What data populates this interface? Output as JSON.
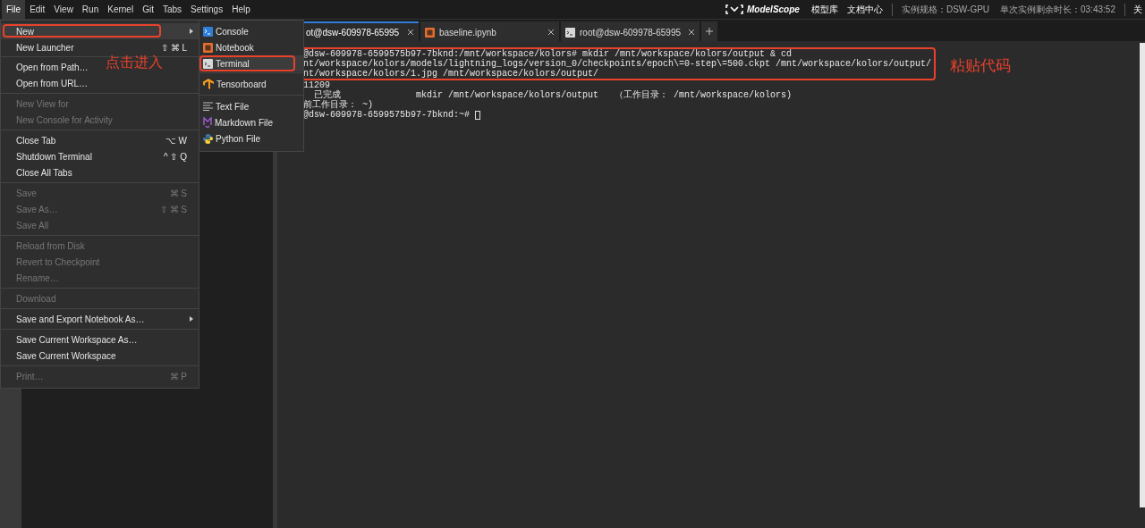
{
  "menubar": {
    "items": [
      {
        "label": "File",
        "selected": true
      },
      {
        "label": "Edit",
        "selected": false
      },
      {
        "label": "View",
        "selected": false
      },
      {
        "label": "Run",
        "selected": false
      },
      {
        "label": "Kernel",
        "selected": false
      },
      {
        "label": "Git",
        "selected": false
      },
      {
        "label": "Tabs",
        "selected": false
      },
      {
        "label": "Settings",
        "selected": false
      },
      {
        "label": "Help",
        "selected": false
      }
    ]
  },
  "header": {
    "brand": "ModelScope",
    "links": [
      "模型库",
      "文档中心"
    ],
    "instance_spec": "实例规格：DSW-GPU",
    "remaining_time": "单次实例剩余时长：03:43:52",
    "close": "关"
  },
  "file_menu": {
    "groups": [
      [
        {
          "label": "New",
          "disabled": false,
          "submenu": true,
          "selected": true,
          "outlined": true
        },
        {
          "label": "New Launcher",
          "shortcut": "⇧ ⌘ L",
          "disabled": false,
          "submenu": false,
          "selected": false,
          "outlined": false
        }
      ],
      [
        {
          "label": "Open from Path…",
          "disabled": false,
          "submenu": false,
          "selected": false,
          "outlined": false
        },
        {
          "label": "Open from URL…",
          "disabled": false,
          "submenu": false,
          "selected": false,
          "outlined": false
        }
      ],
      [
        {
          "label": "New View for",
          "disabled": true,
          "submenu": false,
          "selected": false,
          "outlined": false
        },
        {
          "label": "New Console for Activity",
          "disabled": true,
          "submenu": false,
          "selected": false,
          "outlined": false
        }
      ],
      [
        {
          "label": "Close Tab",
          "shortcut": "⌥ W",
          "disabled": false,
          "submenu": false,
          "selected": false,
          "outlined": false
        },
        {
          "label": "Shutdown Terminal",
          "shortcut": "^ ⇧ Q",
          "disabled": false,
          "submenu": false,
          "selected": false,
          "outlined": false
        },
        {
          "label": "Close All Tabs",
          "disabled": false,
          "submenu": false,
          "selected": false,
          "outlined": false
        }
      ],
      [
        {
          "label": "Save",
          "shortcut": "⌘ S",
          "disabled": true,
          "submenu": false,
          "selected": false,
          "outlined": false
        },
        {
          "label": "Save As…",
          "shortcut": "⇧ ⌘ S",
          "disabled": true,
          "submenu": false,
          "selected": false,
          "outlined": false
        },
        {
          "label": "Save All",
          "disabled": true,
          "submenu": false,
          "selected": false,
          "outlined": false
        }
      ],
      [
        {
          "label": "Reload from Disk",
          "disabled": true,
          "submenu": false,
          "selected": false,
          "outlined": false
        },
        {
          "label": "Revert to Checkpoint",
          "disabled": true,
          "submenu": false,
          "selected": false,
          "outlined": false
        },
        {
          "label": "Rename…",
          "disabled": true,
          "submenu": false,
          "selected": false,
          "outlined": false
        }
      ],
      [
        {
          "label": "Download",
          "disabled": true,
          "submenu": false,
          "selected": false,
          "outlined": false
        }
      ],
      [
        {
          "label": "Save and Export Notebook As…",
          "disabled": false,
          "submenu": true,
          "selected": false,
          "outlined": false
        }
      ],
      [
        {
          "label": "Save Current Workspace As…",
          "disabled": false,
          "submenu": false,
          "selected": false,
          "outlined": false
        },
        {
          "label": "Save Current Workspace",
          "disabled": false,
          "submenu": false,
          "selected": false,
          "outlined": false
        }
      ],
      [
        {
          "label": "Print…",
          "shortcut": "⌘ P",
          "disabled": true,
          "submenu": false,
          "selected": false,
          "outlined": false
        }
      ]
    ]
  },
  "new_submenu": {
    "groups": [
      [
        {
          "label": "Console",
          "kind": "console",
          "selected": false,
          "outlined": false
        },
        {
          "label": "Notebook",
          "kind": "notebook",
          "selected": false,
          "outlined": false
        },
        {
          "label": "Terminal",
          "kind": "terminal",
          "selected": true,
          "outlined": true
        }
      ],
      [
        {
          "label": "Tensorboard",
          "kind": "tensorboard",
          "selected": false,
          "outlined": false
        }
      ],
      [
        {
          "label": "Text File",
          "kind": "text",
          "selected": false,
          "outlined": false
        },
        {
          "label": "Markdown File",
          "kind": "markdown",
          "selected": false,
          "outlined": false
        },
        {
          "label": "Python File",
          "kind": "python",
          "selected": false,
          "outlined": false
        }
      ]
    ]
  },
  "tabs": [
    {
      "label": "ot@dsw-609978-65995",
      "kind": "plain",
      "selected": true
    },
    {
      "label": "baseline.ipynb",
      "kind": "notebook",
      "selected": false
    },
    {
      "label": "root@dsw-609978-65995",
      "kind": "terminal",
      "selected": false
    }
  ],
  "terminal": {
    "pasted_lines": [
      "@dsw-609978-6599575b97-7bknd:/mnt/workspace/kolors# mkdir /mnt/workspace/kolors/output & cd",
      "nt/workspace/kolors/models/lightning_logs/version_0/checkpoints/epoch\\=0-step\\=500.ckpt /mnt/workspace/kolors/output/",
      "nt/workspace/kolors/1.jpg /mnt/workspace/kolors/output/"
    ],
    "output_lines": [
      "11209",
      "  已完成              mkdir /mnt/workspace/kolors/output   （工作目录： /mnt/workspace/kolors)",
      "前工作目录： ~)",
      "@dsw-609978-6599575b97-7bknd:~# "
    ],
    "cursor": true
  },
  "annotations": [
    "点击进入",
    "粘贴代码"
  ]
}
